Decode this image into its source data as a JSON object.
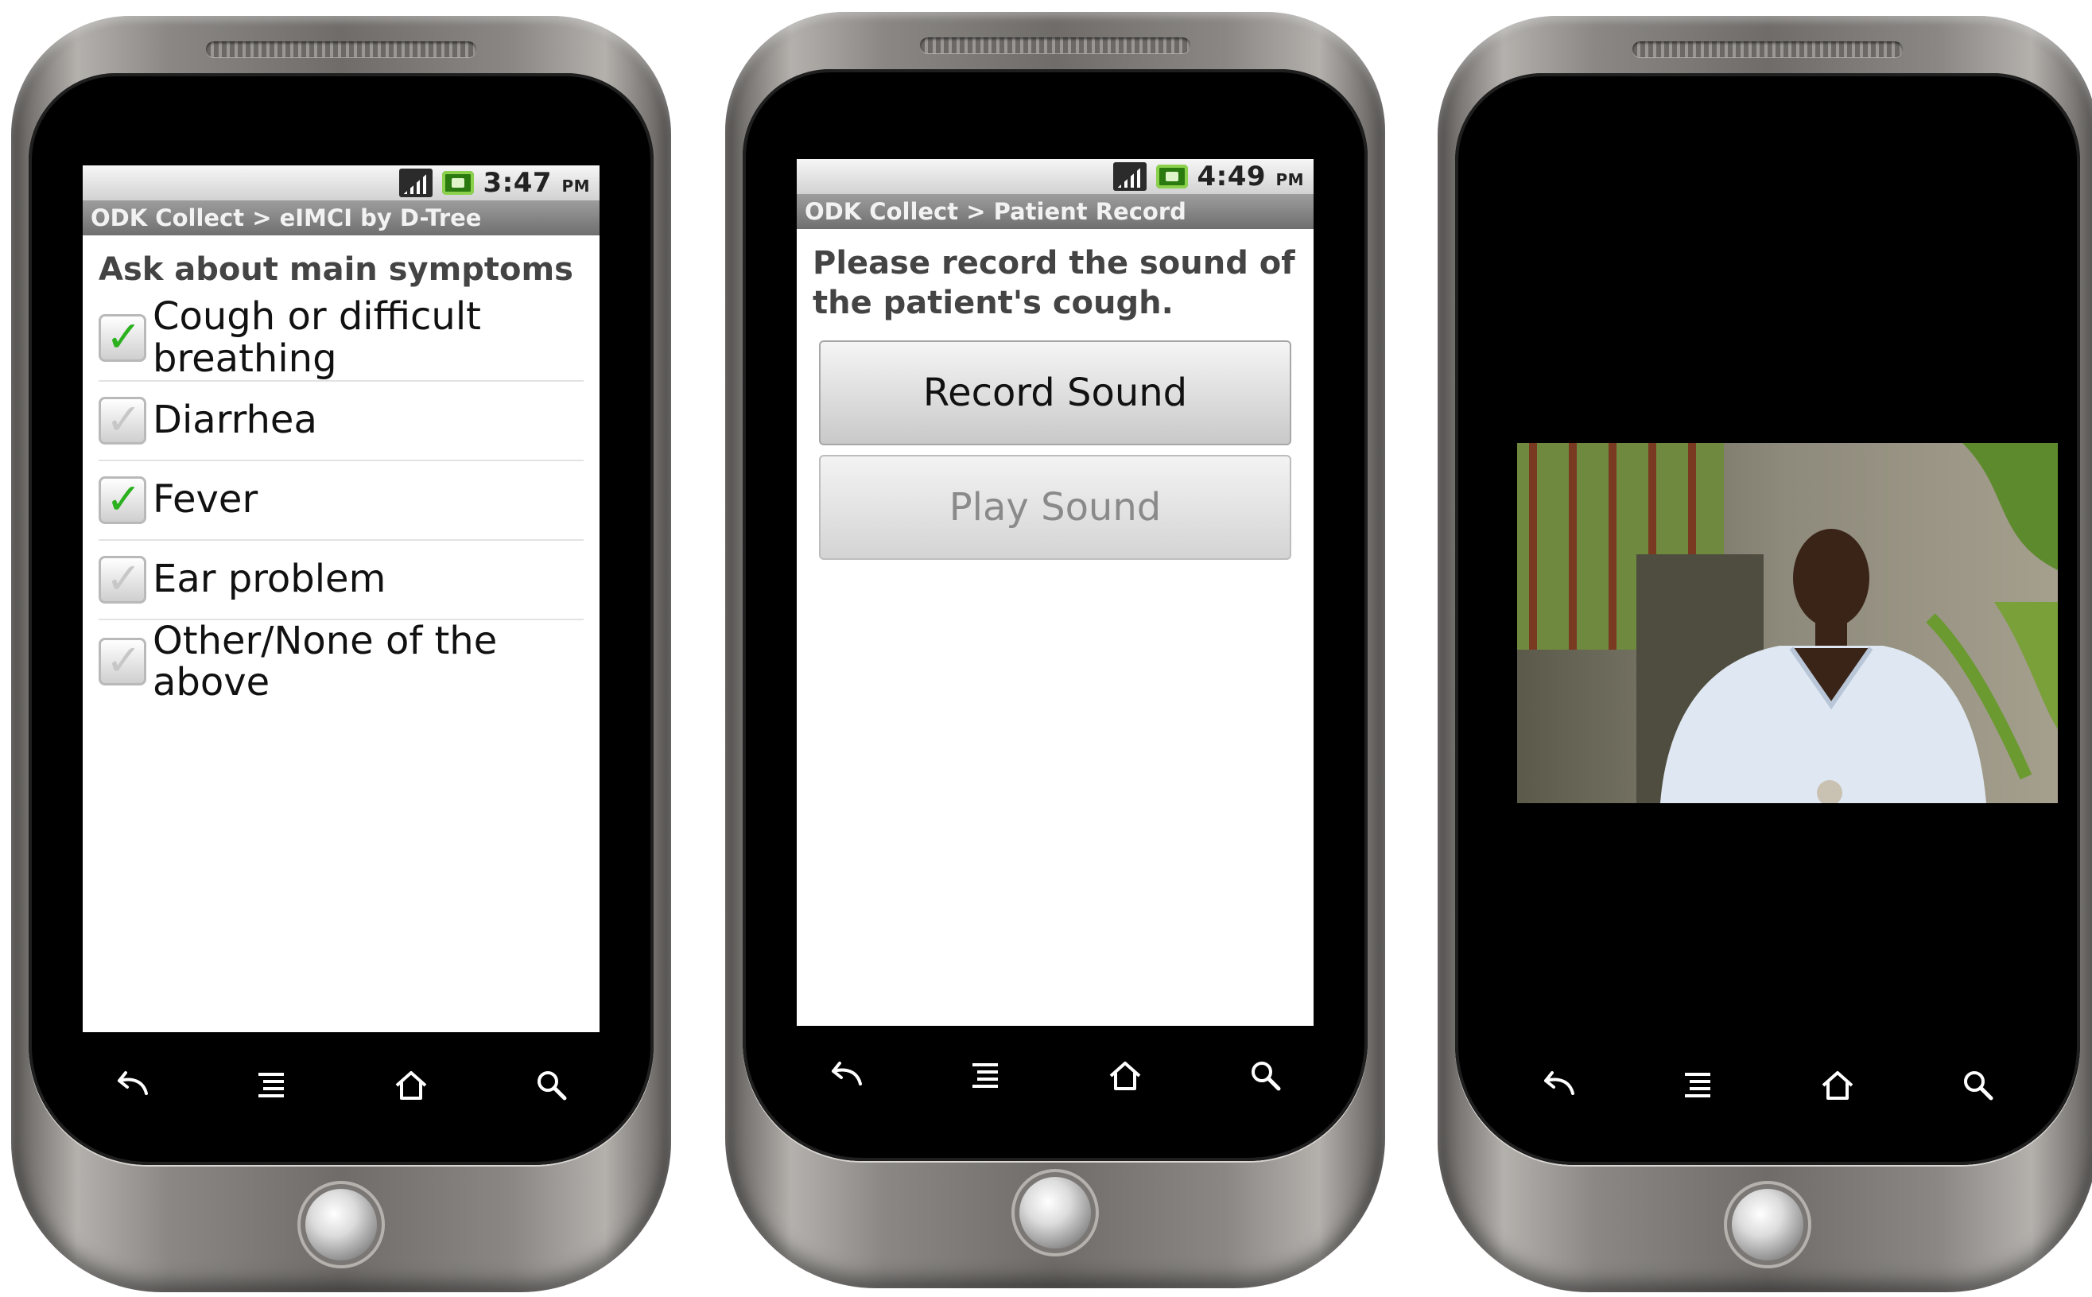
{
  "screens": [
    {
      "status": {
        "time": "3:47",
        "ampm": "PM"
      },
      "title": "ODK Collect > eIMCI by D-Tree",
      "question": "Ask about main symptoms",
      "options": [
        {
          "label": "Cough or difficult breathing",
          "checked": true
        },
        {
          "label": "Diarrhea",
          "checked": false
        },
        {
          "label": "Fever",
          "checked": true
        },
        {
          "label": "Ear problem",
          "checked": false
        },
        {
          "label": "Other/None of the above",
          "checked": false
        }
      ]
    },
    {
      "status": {
        "time": "4:49",
        "ampm": "PM"
      },
      "title": "ODK Collect > Patient Record",
      "question": "Please record the sound of the patient's cough.",
      "buttons": {
        "record": "Record Sound",
        "play": "Play Sound"
      }
    },
    {
      "video": {
        "description_icon": "video-frame"
      }
    }
  ],
  "nav_icons": [
    "back-icon",
    "menu-icon",
    "home-icon",
    "search-icon"
  ]
}
